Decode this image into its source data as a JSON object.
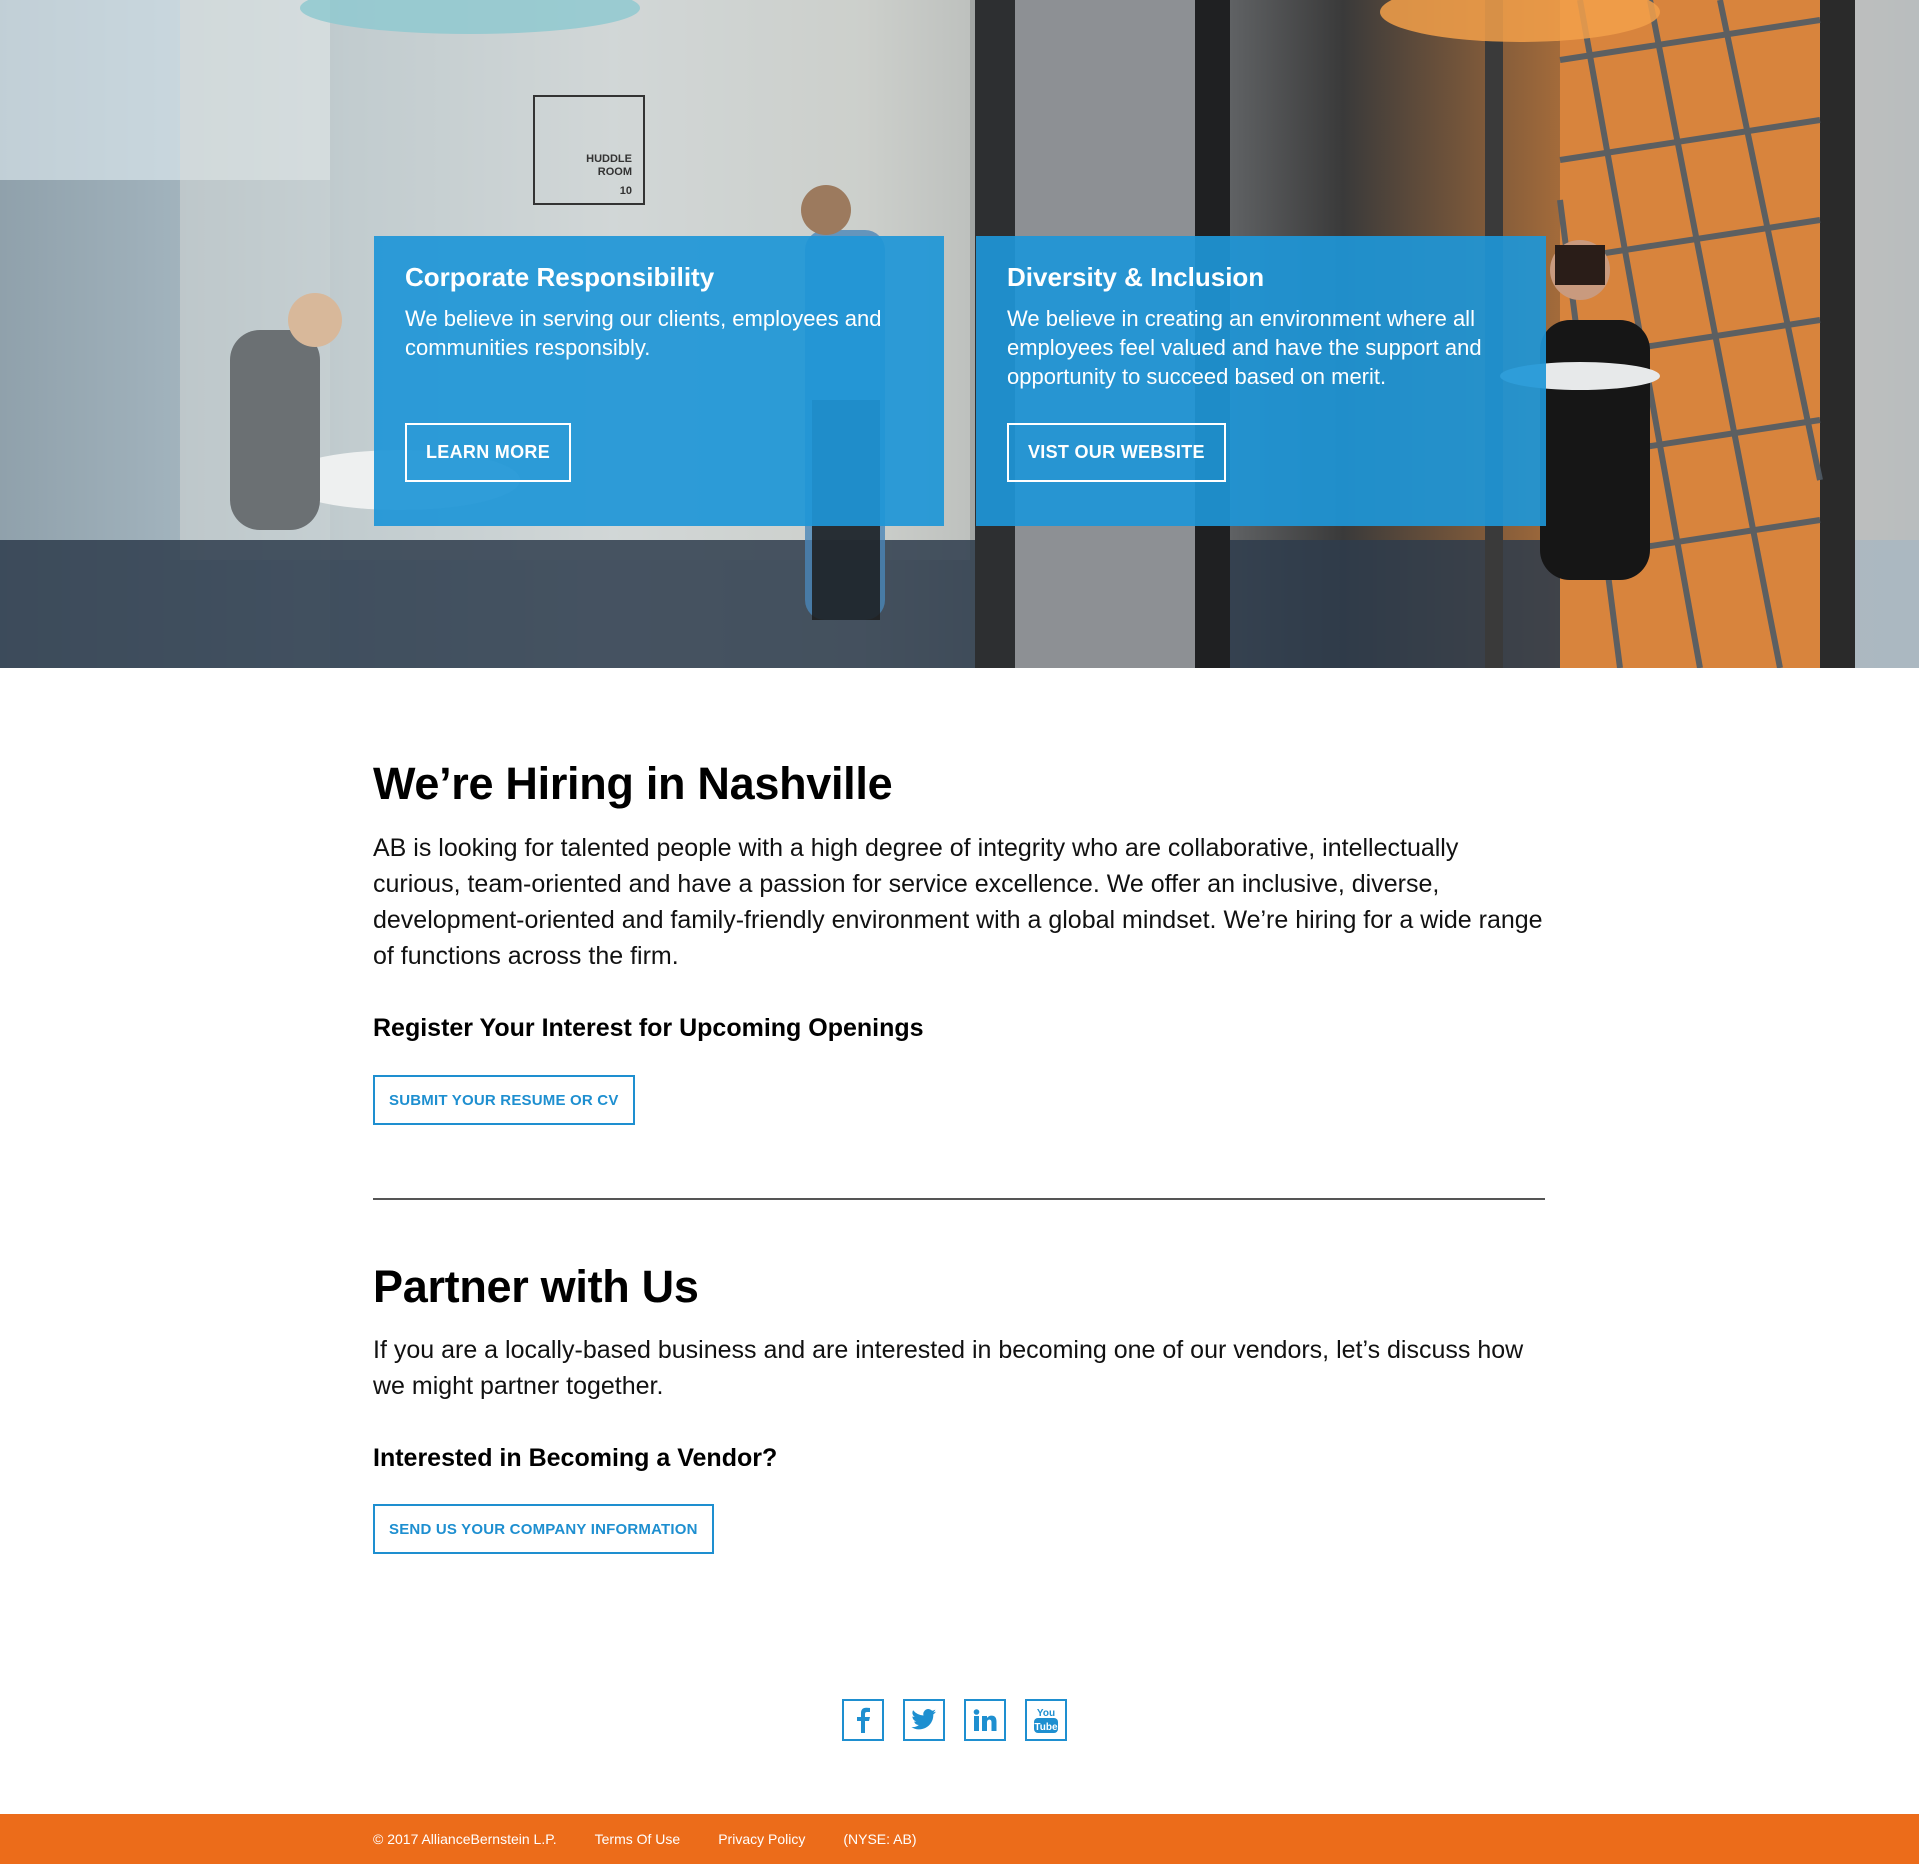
{
  "hero": {
    "sign_text_1": "HUDDLE",
    "sign_text_2": "ROOM",
    "sign_text_3": "10",
    "cards": [
      {
        "title": "Corporate Responsibility",
        "text": "We believe in serving our clients, employees and communities responsibly.",
        "button": "LEARN MORE"
      },
      {
        "title": "Diversity & Inclusion",
        "text": "We believe in creating an environment where all employees feel valued and have the support and opportunity to succeed based on merit.",
        "button": "VIST OUR WEBSITE"
      }
    ]
  },
  "hiring": {
    "title": "We’re Hiring in Nashville",
    "text": "AB is looking for talented people with a high degree of integrity who are collaborative, intellectually curious, team-oriented and have a passion for service excellence. We offer an inclusive, diverse, development-oriented and family-friendly environment with a global mindset. We’re hiring for a wide range of functions across the firm.",
    "subtitle": "Register Your Interest for Upcoming Openings",
    "button": "SUBMIT YOUR RESUME OR CV"
  },
  "partner": {
    "title": "Partner with Us",
    "text": "If you are a locally-based business and are interested in becoming one of our vendors, let’s discuss how we might partner together.",
    "subtitle": "Interested in Becoming a Vendor?",
    "button": "SEND US YOUR COMPANY INFORMATION"
  },
  "social": {
    "icons": [
      "facebook-icon",
      "twitter-icon",
      "linkedin-icon",
      "youtube-icon"
    ],
    "youtube_label_top": "You",
    "youtube_label_bottom": "Tube"
  },
  "footer": {
    "copyright": "© 2017 AllianceBernstein L.P.",
    "terms": "Terms Of Use",
    "privacy": "Privacy Policy",
    "ticker": "(NYSE: AB)"
  },
  "colors": {
    "accent_blue": "#1e8fd0",
    "card_blue": "#1e96d7",
    "footer_orange": "#ec6c1a"
  }
}
